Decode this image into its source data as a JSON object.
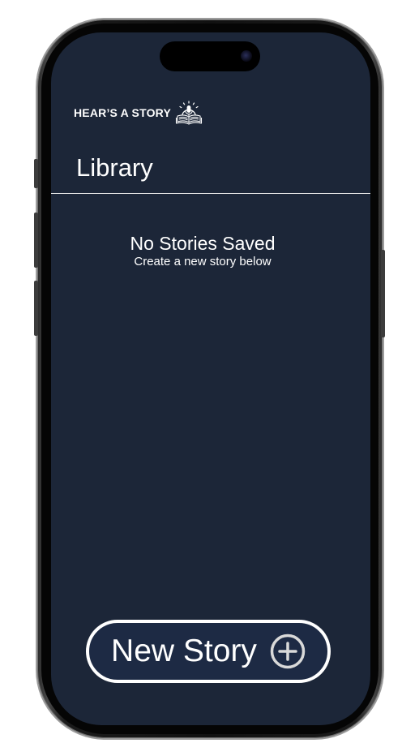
{
  "app": {
    "brand_name": "HEAR’S A STORY",
    "logo_icon": "open-book-microphone-icon"
  },
  "library": {
    "title": "Library",
    "empty_title": "No Stories Saved",
    "empty_subtitle": "Create a new story below"
  },
  "actions": {
    "new_story_label": "New Story",
    "new_story_icon": "plus-circle-icon"
  },
  "colors": {
    "screen_background": "#1c2638",
    "button_background": "#1d2a44",
    "text": "#ffffff"
  }
}
